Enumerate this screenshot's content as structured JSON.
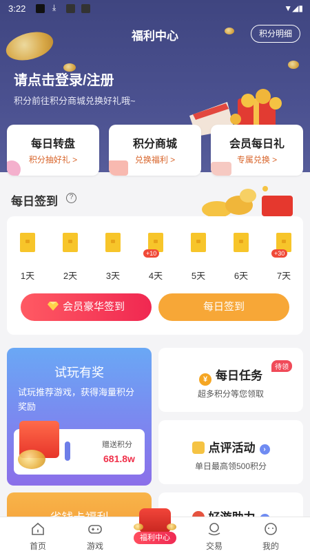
{
  "status_bar": {
    "time": "3:22"
  },
  "header": {
    "title": "福利中心",
    "detail_button": "积分明细",
    "login_text": "请点击登录/注册",
    "login_subtitle": "积分前往积分商城兑换好礼哦~"
  },
  "feature_cards": [
    {
      "title": "每日转盘",
      "subtitle": "积分抽好礼 >"
    },
    {
      "title": "积分商城",
      "subtitle": "兑换福利 >"
    },
    {
      "title": "会员每日礼",
      "subtitle": "专属兑换 >"
    }
  ],
  "sign_in": {
    "title": "每日签到",
    "help_icon": "?",
    "days": [
      {
        "label": "1天",
        "bonus": ""
      },
      {
        "label": "2天",
        "bonus": ""
      },
      {
        "label": "3天",
        "bonus": ""
      },
      {
        "label": "4天",
        "bonus": "+10"
      },
      {
        "label": "5天",
        "bonus": ""
      },
      {
        "label": "6天",
        "bonus": ""
      },
      {
        "label": "7天",
        "bonus": "+30"
      }
    ],
    "vip_button": "会员豪华签到",
    "daily_button": "每日签到"
  },
  "trial": {
    "title": "试玩有奖",
    "description": "试玩推荐游戏，获得海量积分奖励",
    "points_label": "赠送积分",
    "points_value": "681.8w"
  },
  "tasks": [
    {
      "title": "每日任务",
      "subtitle": "超多积分等您领取",
      "badge": "待领",
      "icon": "¥"
    },
    {
      "title": "点评活动",
      "subtitle": "单日最高领500积分",
      "badge": "",
      "icon": ""
    }
  ],
  "bottom_cards": {
    "save_card": "省钱卡福利",
    "help_card": "好游助力"
  },
  "tab_bar": {
    "items": [
      "首页",
      "游戏",
      "福利中心",
      "交易",
      "我的"
    ]
  },
  "colors": {
    "header_bg": "#4b5190",
    "accent_orange": "#f7a737",
    "accent_red": "#f02851",
    "envelope": "#f7c52a"
  }
}
